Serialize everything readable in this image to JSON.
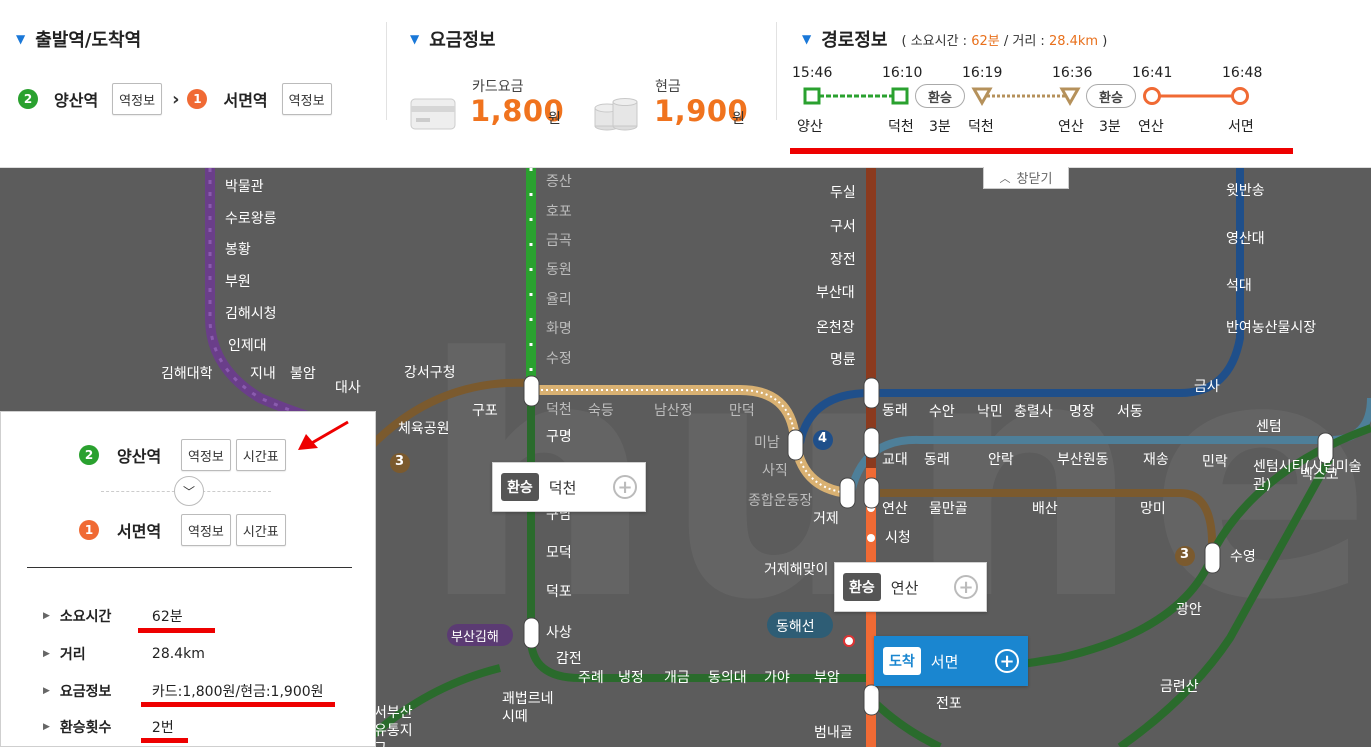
{
  "depart_arrive": {
    "title": "출발역/도착역",
    "origin": {
      "line": "2",
      "name": "양산역",
      "info_btn": "역정보"
    },
    "destination": {
      "line": "1",
      "name": "서면역",
      "info_btn": "역정보"
    }
  },
  "fare": {
    "title": "요금정보",
    "card_label": "카드요금",
    "card_value": "1,800",
    "cash_label": "현금",
    "cash_value": "1,900",
    "unit": "원"
  },
  "route": {
    "title": "경로정보",
    "meta_prefix": "( 소요시간 :",
    "duration": "62분",
    "meta_sep": "/ 거리 :",
    "distance": "28.4km",
    "meta_suffix": ")",
    "times": [
      "15:46",
      "16:10",
      "16:19",
      "16:36",
      "16:41",
      "16:48"
    ],
    "stops": [
      "양산",
      "덕천",
      "3분",
      "덕천",
      "연산",
      "3분",
      "연산",
      "서면"
    ],
    "transfer_label": "환승",
    "colors": {
      "line2": "#2aa12f",
      "line3": "#b5915b",
      "line1": "#f06a34",
      "highlight": "#ee0000"
    }
  },
  "map": {
    "close_tab": "창닫기",
    "callouts": {
      "transfer1": {
        "tag": "환승",
        "name": "덕천"
      },
      "transfer2": {
        "tag": "환승",
        "name": "연산"
      },
      "arrive": {
        "tag": "도착",
        "name": "서면"
      }
    },
    "stations": {
      "purple": [
        "박물관",
        "수로왕릉",
        "봉황",
        "부원",
        "김해시청",
        "인제대",
        "김해대학",
        "지내",
        "불암",
        "대사"
      ],
      "green_line": [
        "증산",
        "호포",
        "금곡",
        "동원",
        "율리",
        "화명",
        "수정",
        "덕천",
        "구명",
        "구남",
        "모덕",
        "덕포",
        "사상"
      ],
      "orange_line": [
        "두실",
        "구서",
        "장전",
        "부산대",
        "온천장",
        "명륜",
        "동래",
        "교대",
        "연산",
        "시청",
        "거제해맞이",
        "부암",
        "범내골"
      ],
      "line3": [
        "구포",
        "숙등",
        "남산정",
        "만덕",
        "미남",
        "사직",
        "종합운동장",
        "거제",
        "강서구청",
        "체육공원"
      ],
      "blue_line": [
        "수안",
        "낙민",
        "충렬사",
        "명장",
        "서동",
        "금사"
      ],
      "line4": [
        "동래",
        "안락",
        "부산원동",
        "재송",
        "센텀",
        "민락",
        "센텀시티(시립미술관)",
        "벡스코",
        "수영"
      ],
      "right_col": [
        "윗반송",
        "영산대",
        "석대",
        "반여농산물시장",
        "광안",
        "금련산",
        "전포"
      ],
      "misc": [
        "물만골",
        "배산",
        "망미",
        "감전",
        "주례",
        "냉정",
        "개금",
        "동의대",
        "가야",
        "괘법르네시떼",
        "서부산유통지구",
        "부산김해",
        "동해선"
      ],
      "badges": [
        "3",
        "4",
        "3"
      ]
    }
  },
  "left_panel": {
    "origin": {
      "line": "2",
      "name": "양산역",
      "info_btn": "역정보",
      "timetable_btn": "시간표"
    },
    "destination": {
      "line": "1",
      "name": "서면역",
      "info_btn": "역정보",
      "timetable_btn": "시간표"
    },
    "rows": [
      {
        "label": "소요시간",
        "value": "62분"
      },
      {
        "label": "거리",
        "value": "28.4km"
      },
      {
        "label": "요금정보",
        "value": "카드:1,800원/현금:1,900원"
      },
      {
        "label": "환승횟수",
        "value": "2번"
      }
    ]
  }
}
